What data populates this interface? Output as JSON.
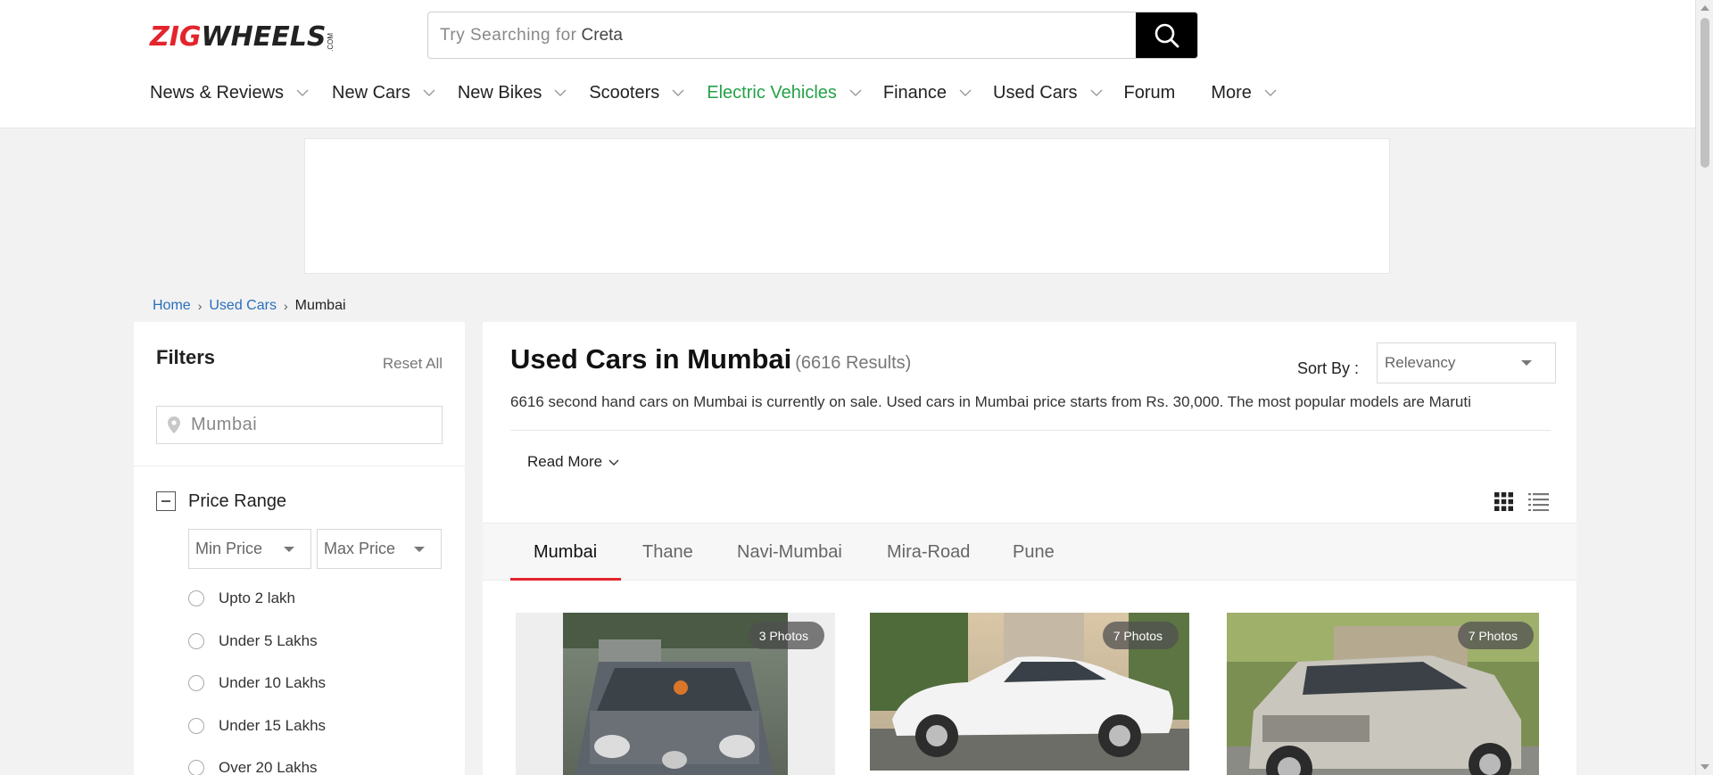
{
  "brand": {
    "logo_part1": "ZIG",
    "logo_part2": "WHEELS",
    "logo_suffix": ".COM"
  },
  "search": {
    "placeholder_prefix": "Try Searching for",
    "placeholder_term": "Creta",
    "button_icon": "search-icon"
  },
  "nav": {
    "items": [
      {
        "label": "News & Reviews",
        "has_dropdown": true
      },
      {
        "label": "New Cars",
        "has_dropdown": true
      },
      {
        "label": "New Bikes",
        "has_dropdown": true
      },
      {
        "label": "Scooters",
        "has_dropdown": true
      },
      {
        "label": "Electric Vehicles",
        "has_dropdown": true,
        "color": "#24a148"
      },
      {
        "label": "Finance",
        "has_dropdown": true
      },
      {
        "label": "Used Cars",
        "has_dropdown": true
      },
      {
        "label": "Forum",
        "has_dropdown": false
      },
      {
        "label": "More",
        "has_dropdown": true
      }
    ]
  },
  "breadcrumb": {
    "home": "Home",
    "used_cars": "Used Cars",
    "current": "Mumbai"
  },
  "filters": {
    "title": "Filters",
    "reset_label": "Reset All",
    "location_value": "Mumbai",
    "price_range": {
      "title": "Price Range",
      "min_placeholder": "Min Price",
      "max_placeholder": "Max Price",
      "options": [
        "Upto 2 lakh",
        "Under 5 Lakhs",
        "Under 10 Lakhs",
        "Under 15 Lakhs",
        "Over 20 Lakhs"
      ]
    }
  },
  "main": {
    "title": "Used Cars in Mumbai",
    "results_count": "(6616 Results)",
    "sort_label": "Sort By :",
    "sort_value": "Relevancy",
    "description": "6616 second hand cars on Mumbai is currently on sale. Used cars in Mumbai price starts from Rs. 30,000. The most popular models are Maruti",
    "read_more": "Read More",
    "tabs": [
      "Mumbai",
      "Thane",
      "Navi-Mumbai",
      "Mira-Road",
      "Pune"
    ],
    "active_tab": "Mumbai"
  },
  "cars": [
    {
      "photos_label": "3 Photos"
    },
    {
      "photos_label": "7 Photos"
    },
    {
      "photos_label": "7 Photos"
    }
  ],
  "colors": {
    "brand_red": "#e4242c",
    "ev_green": "#24a148",
    "link_blue": "#2a6ebb"
  }
}
